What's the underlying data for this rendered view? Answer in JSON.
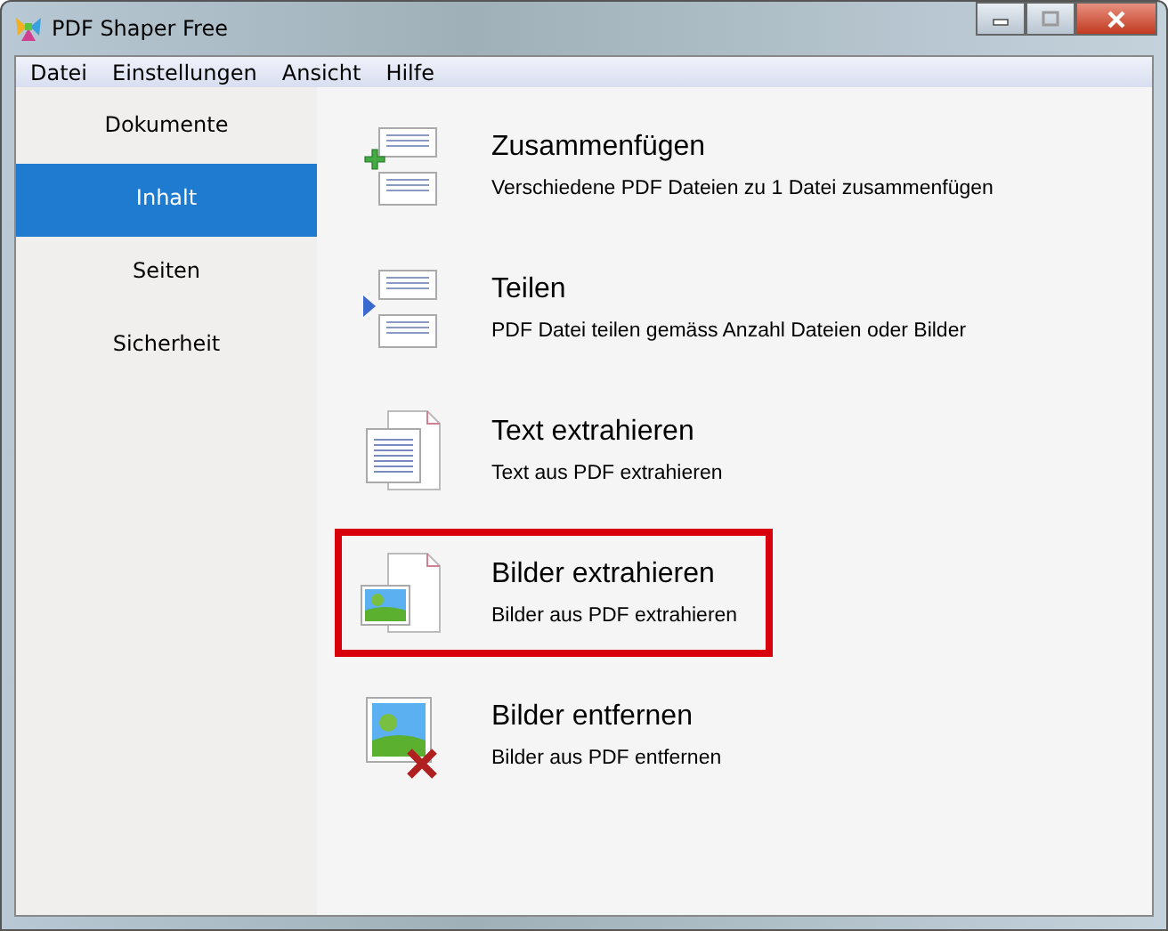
{
  "window": {
    "title": "PDF Shaper Free"
  },
  "menu": [
    "Datei",
    "Einstellungen",
    "Ansicht",
    "Hilfe"
  ],
  "sidebar": {
    "items": [
      {
        "label": "Dokumente",
        "selected": false
      },
      {
        "label": "Inhalt",
        "selected": true
      },
      {
        "label": "Seiten",
        "selected": false
      },
      {
        "label": "Sicherheit",
        "selected": false
      }
    ]
  },
  "actions": [
    {
      "kind": "merge",
      "title": "Zusammenfügen",
      "description": "Verschiedene PDF Dateien zu 1 Datei zusammenfügen",
      "highlighted": false
    },
    {
      "kind": "split",
      "title": "Teilen",
      "description": "PDF Datei teilen gemäss Anzahl Dateien oder Bilder",
      "highlighted": false
    },
    {
      "kind": "text",
      "title": "Text extrahieren",
      "description": "Text aus PDF extrahieren",
      "highlighted": false
    },
    {
      "kind": "images",
      "title": "Bilder extrahieren",
      "description": "Bilder aus PDF extrahieren",
      "highlighted": true
    },
    {
      "kind": "remove",
      "title": "Bilder entfernen",
      "description": "Bilder aus PDF entfernen",
      "highlighted": false
    }
  ]
}
